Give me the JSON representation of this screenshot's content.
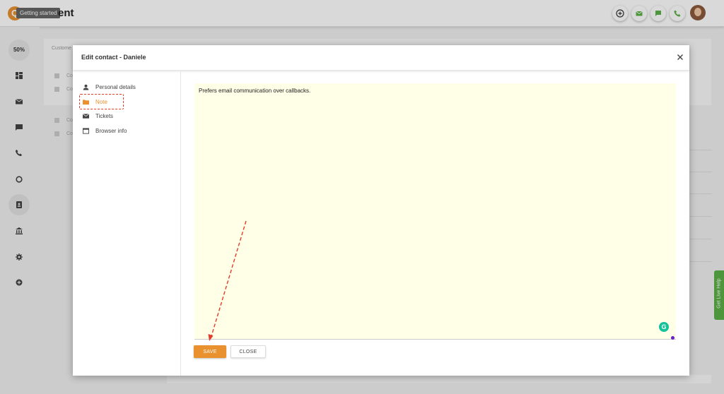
{
  "topbar": {
    "logo_letter": "Q",
    "tooltip": "Getting started",
    "title_fragment": "ent",
    "icons": [
      "add-circle-icon",
      "email-icon",
      "chat-icon",
      "phone-icon"
    ]
  },
  "leftnav": {
    "progress_label": "50%",
    "icons": [
      "dashboard-icon",
      "email-icon",
      "chat-icon",
      "phone-icon",
      "reports-icon",
      "contacts-icon",
      "bank-icon",
      "settings-icon",
      "add-icon"
    ]
  },
  "background": {
    "section_label": "Custome",
    "rows": [
      "Co",
      "Co",
      "Co",
      "Co"
    ]
  },
  "help_tab": {
    "label": "Get Live Help"
  },
  "modal": {
    "title": "Edit contact - Daniele",
    "sidebar": [
      {
        "label": "Personal details",
        "icon": "person-icon"
      },
      {
        "label": "Note",
        "icon": "folder-icon"
      },
      {
        "label": "Tickets",
        "icon": "email-icon"
      },
      {
        "label": "Browser info",
        "icon": "browser-icon"
      }
    ],
    "note_text": "Prefers email communication over callbacks.",
    "grammarly_letter": "G",
    "save_label": "SAVE",
    "close_label": "CLOSE"
  },
  "colors": {
    "accent": "#e8912e",
    "annotation": "#e53b2c",
    "note_bg": "#fffee6",
    "help_green": "#5bb147"
  }
}
